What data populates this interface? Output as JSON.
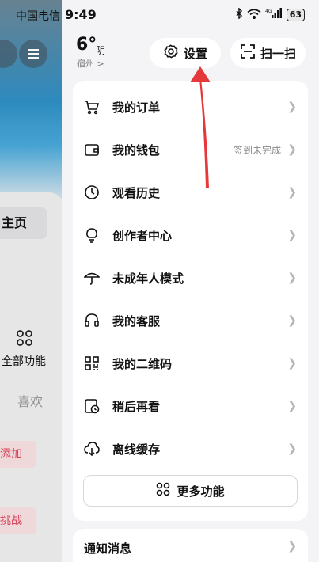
{
  "status_bar": {
    "carrier": "中国电信",
    "time": "9:49",
    "battery": "63",
    "network": "4G"
  },
  "background_page": {
    "home_label": "主页",
    "all_features_label": "全部功能",
    "like_label": "喜欢",
    "add_label": "添加",
    "challenge_label": "挑战"
  },
  "weather": {
    "temperature": "6°",
    "condition": "阴",
    "location": "宿州 >"
  },
  "header": {
    "settings_label": "设置",
    "scan_label": "扫一扫"
  },
  "menu": {
    "items": [
      {
        "label": "我的订单",
        "icon": "cart-icon",
        "status": ""
      },
      {
        "label": "我的钱包",
        "icon": "wallet-icon",
        "status": "签到未完成"
      },
      {
        "label": "观看历史",
        "icon": "clock-icon",
        "status": ""
      },
      {
        "label": "创作者中心",
        "icon": "lightbulb-icon",
        "status": ""
      },
      {
        "label": "未成年人模式",
        "icon": "umbrella-icon",
        "status": ""
      },
      {
        "label": "我的客服",
        "icon": "headset-icon",
        "status": ""
      },
      {
        "label": "我的二维码",
        "icon": "qr-code-icon",
        "status": ""
      },
      {
        "label": "稍后再看",
        "icon": "watch-later-icon",
        "status": ""
      },
      {
        "label": "离线缓存",
        "icon": "cloud-download-icon",
        "status": ""
      }
    ],
    "more_label": "更多功能"
  },
  "notifications": {
    "label": "通知消息"
  },
  "colors": {
    "annotation_arrow": "#e5383b",
    "sidebar_accent": "#e0465e",
    "sky_blue": "#2f8fc4"
  }
}
